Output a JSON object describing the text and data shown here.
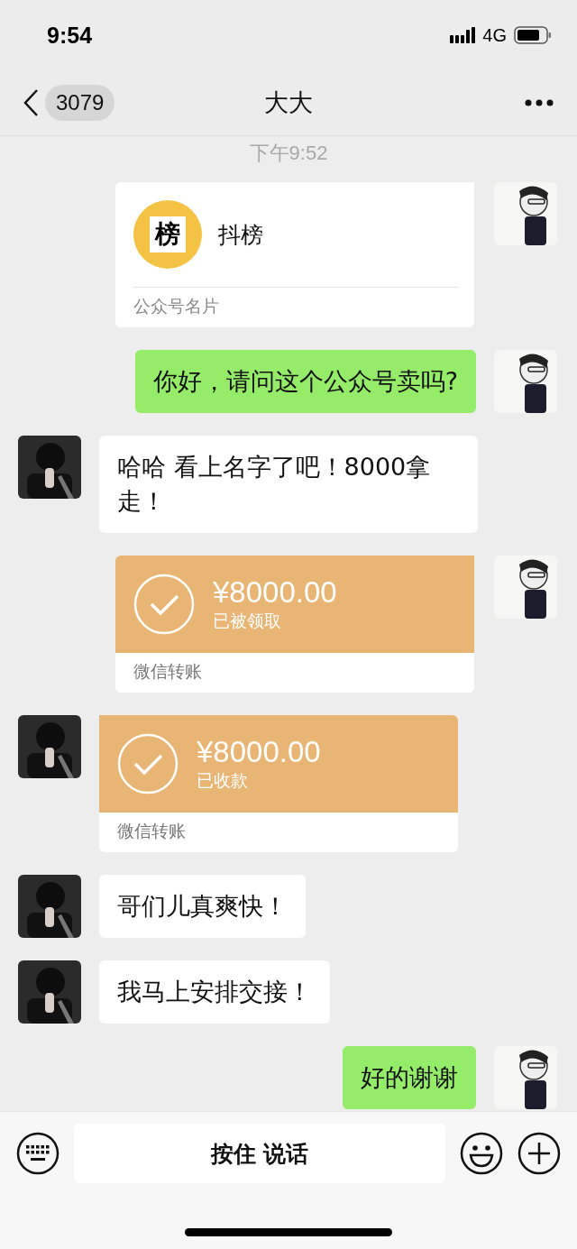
{
  "status_bar": {
    "time": "9:54",
    "network": "4G"
  },
  "nav": {
    "unread": "3079",
    "title": "大大"
  },
  "messages": [
    {
      "kind": "time",
      "text": "下午9:52"
    },
    {
      "kind": "card",
      "outgoing": true,
      "name": "抖榜",
      "logo": "榜",
      "footer": "公众号名片"
    },
    {
      "kind": "text",
      "outgoing": true,
      "text": "你好，请问这个公众号卖吗?"
    },
    {
      "kind": "text",
      "outgoing": false,
      "text": "哈哈 看上名字了吧！8000拿走！"
    },
    {
      "kind": "transfer",
      "outgoing": true,
      "amount": "¥8000.00",
      "status": "已被领取",
      "footer": "微信转账"
    },
    {
      "kind": "transfer",
      "outgoing": false,
      "amount": "¥8000.00",
      "status": "已收款",
      "footer": "微信转账"
    },
    {
      "kind": "text",
      "outgoing": false,
      "text": "哥们儿真爽快！"
    },
    {
      "kind": "text",
      "outgoing": false,
      "text": "我马上安排交接！"
    },
    {
      "kind": "text",
      "outgoing": true,
      "text": "好的谢谢"
    }
  ],
  "input_bar": {
    "hold_to_talk": "按住 说话"
  }
}
